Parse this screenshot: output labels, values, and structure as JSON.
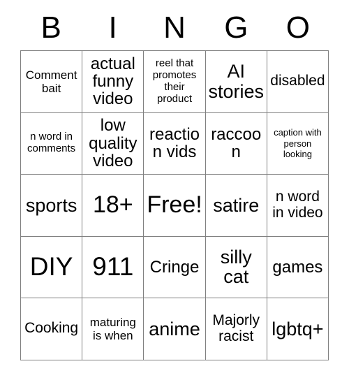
{
  "card": {
    "title": "BINGO",
    "headers": [
      "B",
      "I",
      "N",
      "G",
      "O"
    ],
    "colors": {
      "background": "#ffffff",
      "text": "#000000",
      "grid_line": "#808080"
    },
    "rows": [
      {
        "cells": [
          {
            "text": "Comment bait",
            "size": "md"
          },
          {
            "text": "actual funny video",
            "size": "xl"
          },
          {
            "text": "reel that promotes their product",
            "size": "sm"
          },
          {
            "text": "AI stories",
            "size": "2xl"
          },
          {
            "text": "disabled",
            "size": "lg"
          }
        ]
      },
      {
        "cells": [
          {
            "text": "n word in comments",
            "size": "sm"
          },
          {
            "text": "low quality video",
            "size": "xl"
          },
          {
            "text": "reaction vids",
            "size": "xl"
          },
          {
            "text": "raccoon",
            "size": "xl"
          },
          {
            "text": "caption with person looking",
            "size": "xs"
          }
        ]
      },
      {
        "cells": [
          {
            "text": "sports",
            "size": "2xl"
          },
          {
            "text": "18+",
            "size": "3xl"
          },
          {
            "text": "Free!",
            "size": "3xl"
          },
          {
            "text": "satire",
            "size": "2xl"
          },
          {
            "text": "n word in video",
            "size": "lg"
          }
        ]
      },
      {
        "cells": [
          {
            "text": "DIY",
            "size": "4xl"
          },
          {
            "text": "911",
            "size": "4xl"
          },
          {
            "text": "Cringe",
            "size": "xl"
          },
          {
            "text": "silly cat",
            "size": "2xl"
          },
          {
            "text": "games",
            "size": "xl"
          }
        ]
      },
      {
        "cells": [
          {
            "text": "Cooking",
            "size": "lg"
          },
          {
            "text": "maturing is when",
            "size": "md"
          },
          {
            "text": "anime",
            "size": "2xl"
          },
          {
            "text": "Majorly racist",
            "size": "lg"
          },
          {
            "text": "lgbtq+",
            "size": "2xl"
          }
        ]
      }
    ]
  }
}
